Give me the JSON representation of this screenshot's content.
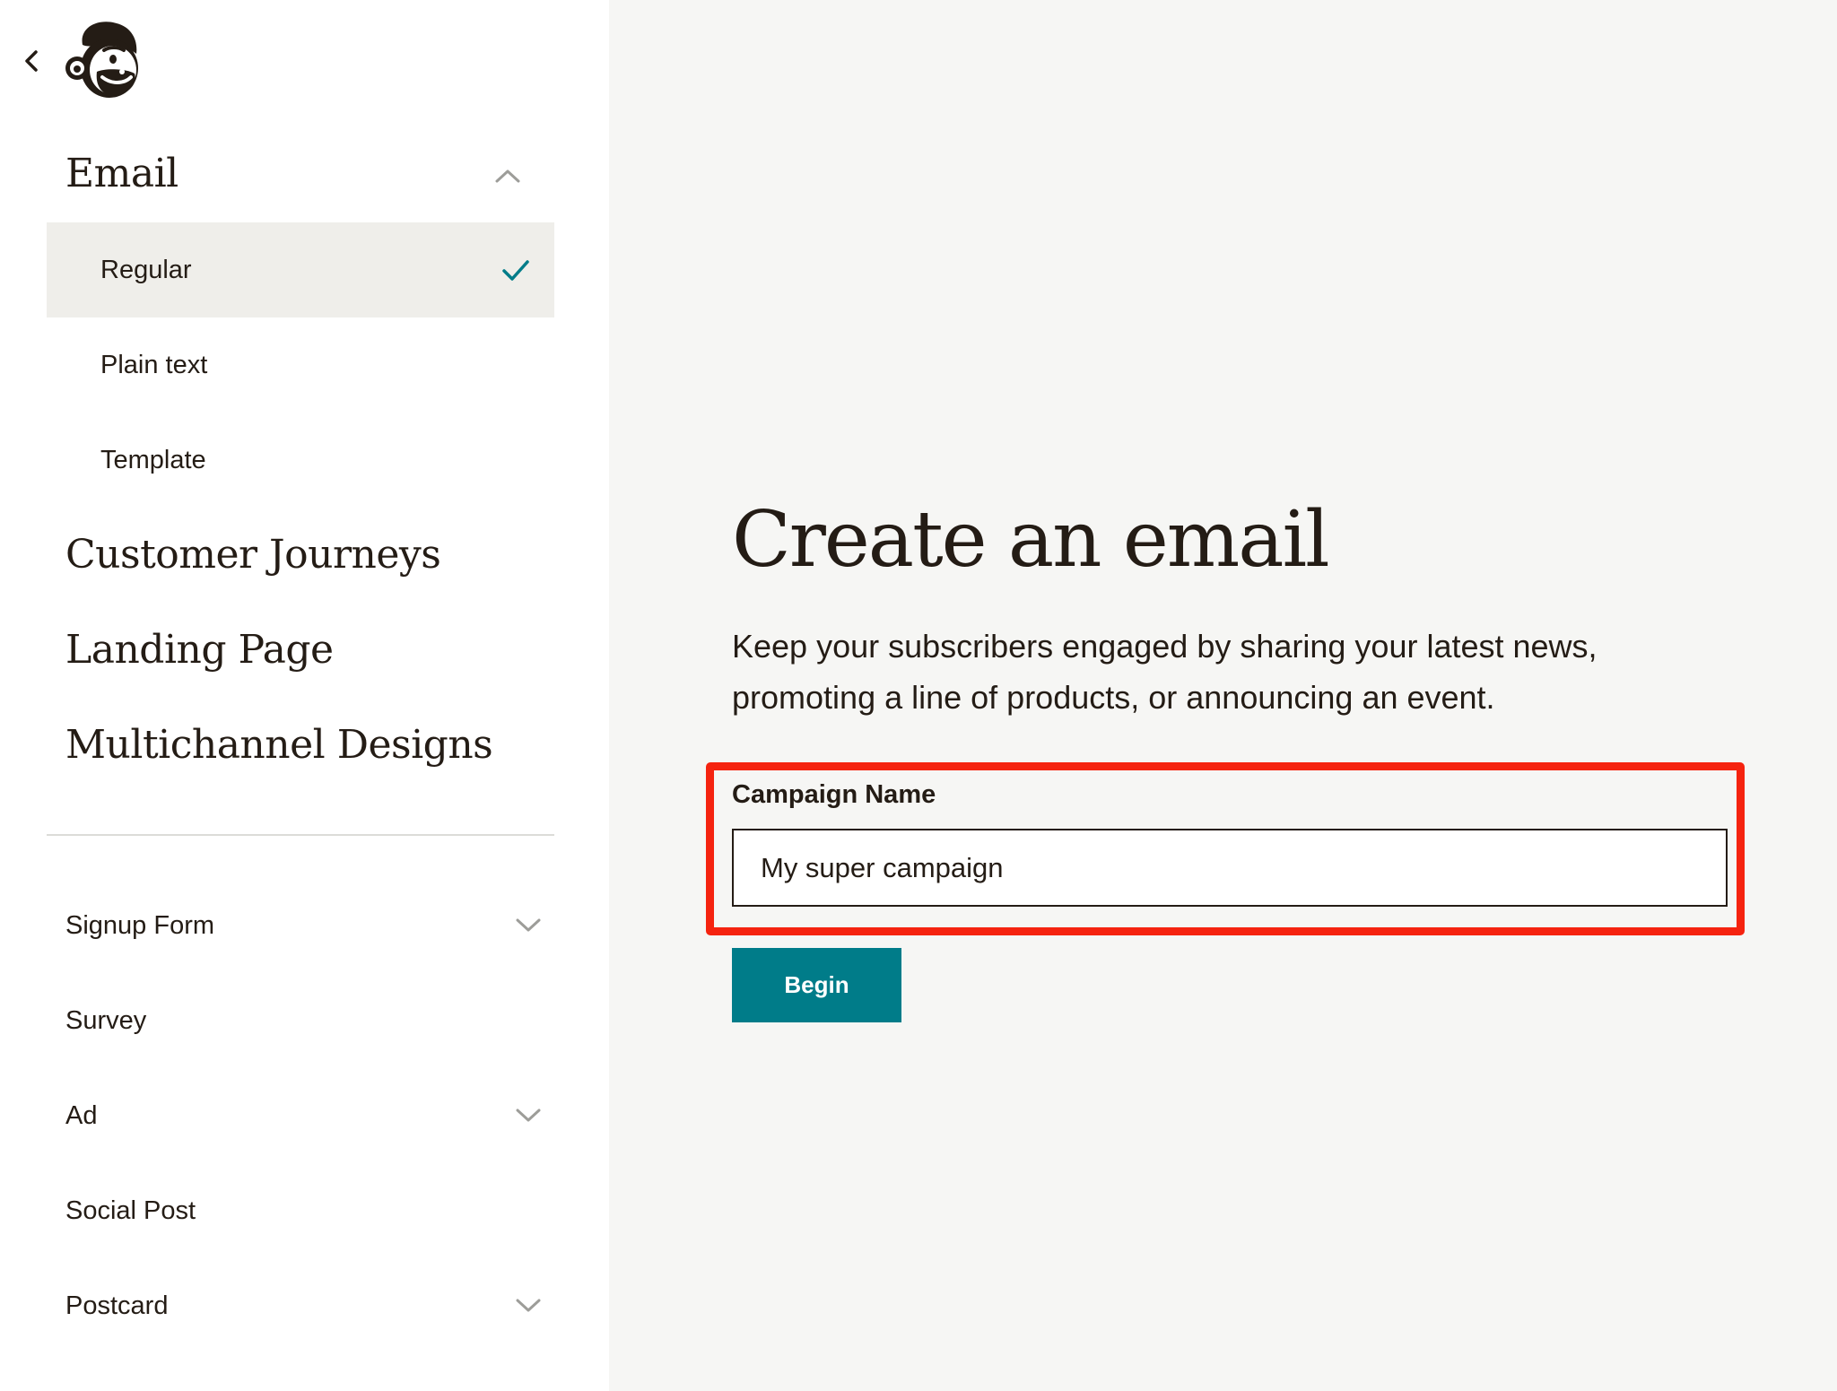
{
  "sidebar": {
    "back_icon": "chevron-left-icon",
    "logo_icon": "mailchimp-freddie-logo",
    "email_section": {
      "title": "Email",
      "expanded": true,
      "items": [
        {
          "label": "Regular",
          "selected": true
        },
        {
          "label": "Plain text",
          "selected": false
        },
        {
          "label": "Template",
          "selected": false
        }
      ]
    },
    "sections": [
      {
        "title": "Customer Journeys"
      },
      {
        "title": "Landing Page"
      },
      {
        "title": "Multichannel Designs"
      }
    ],
    "other_items": [
      {
        "label": "Signup Form",
        "has_submenu": true
      },
      {
        "label": "Survey",
        "has_submenu": false
      },
      {
        "label": "Ad",
        "has_submenu": true
      },
      {
        "label": "Social Post",
        "has_submenu": false
      },
      {
        "label": "Postcard",
        "has_submenu": true
      }
    ]
  },
  "main": {
    "title": "Create an email",
    "description": "Keep your subscribers engaged by sharing your latest news, promoting a line of products, or announcing an event.",
    "campaign_field": {
      "label": "Campaign Name",
      "value": "My super campaign"
    },
    "begin_label": "Begin"
  },
  "colors": {
    "accent": "#007c89",
    "highlight": "#f5230f",
    "text": "#241c15",
    "selected_bg": "#efeeea",
    "page_bg": "#f6f6f4"
  }
}
